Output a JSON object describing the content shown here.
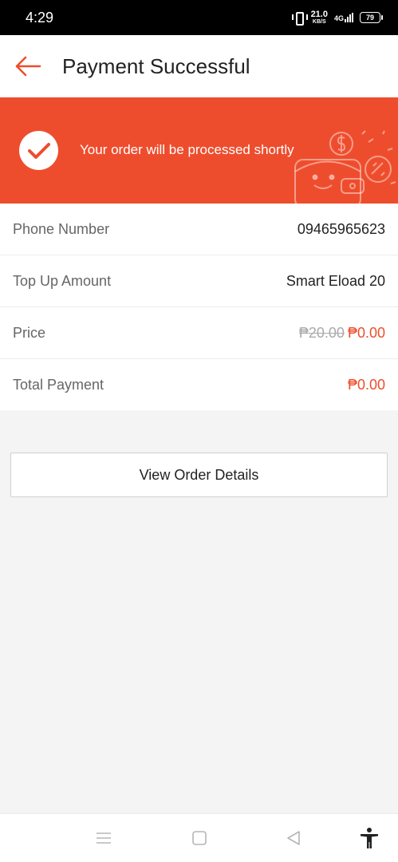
{
  "status_bar": {
    "time": "4:29",
    "net_speed": "21.0",
    "net_speed_unit": "KB/S",
    "network": "4G",
    "battery": "79"
  },
  "header": {
    "title": "Payment Successful"
  },
  "banner": {
    "message": "Your order will be processed shortly",
    "color": "#ee4d2d"
  },
  "details": {
    "phone_label": "Phone Number",
    "phone_value": "09465965623",
    "topup_label": "Top Up Amount",
    "topup_value": "Smart Eload 20",
    "price_label": "Price",
    "price_original": "₱20.00",
    "price_final": "₱0.00",
    "total_label": "Total Payment",
    "total_value": "₱0.00"
  },
  "actions": {
    "view_order_label": "View Order Details"
  },
  "nav": {
    "icons": [
      "menu-icon",
      "home-square-icon",
      "back-triangle-icon",
      "accessibility-icon"
    ]
  }
}
